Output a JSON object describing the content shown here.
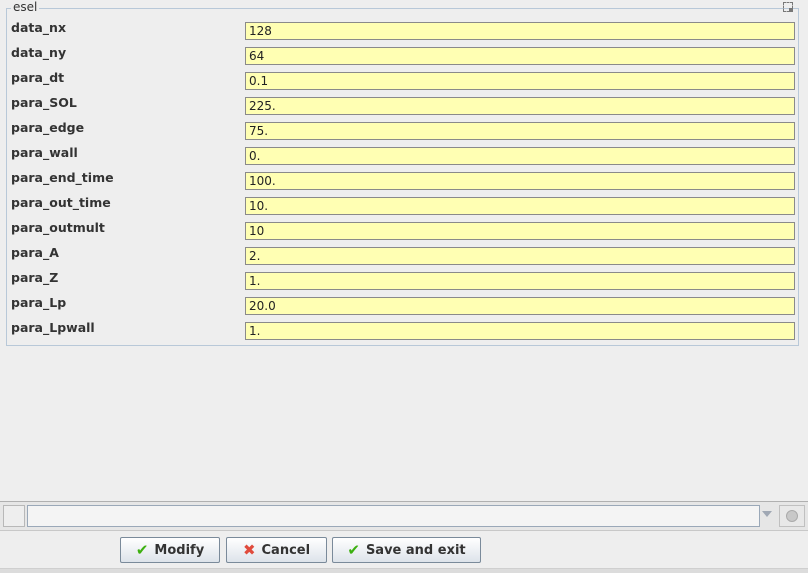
{
  "group": {
    "title": "esel"
  },
  "fields": [
    {
      "label": "data_nx",
      "value": "128"
    },
    {
      "label": "data_ny",
      "value": "64"
    },
    {
      "label": "para_dt",
      "value": "0.1"
    },
    {
      "label": "para_SOL",
      "value": "225."
    },
    {
      "label": "para_edge",
      "value": "75."
    },
    {
      "label": "para_wall",
      "value": "0."
    },
    {
      "label": "para_end_time",
      "value": "100."
    },
    {
      "label": "para_out_time",
      "value": "10."
    },
    {
      "label": "para_outmult",
      "value": "10"
    },
    {
      "label": "para_A",
      "value": "2."
    },
    {
      "label": "para_Z",
      "value": "1."
    },
    {
      "label": "para_Lp",
      "value": "20.0"
    },
    {
      "label": "para_Lpwall",
      "value": "1."
    }
  ],
  "statusbar": {
    "value": ""
  },
  "buttons": {
    "modify": "Modify",
    "cancel": "Cancel",
    "save_exit": "Save and exit"
  },
  "icons": {
    "check": "check-icon",
    "cross": "cross-icon",
    "stop": "stop-icon"
  },
  "colors": {
    "field_bg": "#ffffb3",
    "check": "#3cb010",
    "cross": "#e04b3c"
  }
}
